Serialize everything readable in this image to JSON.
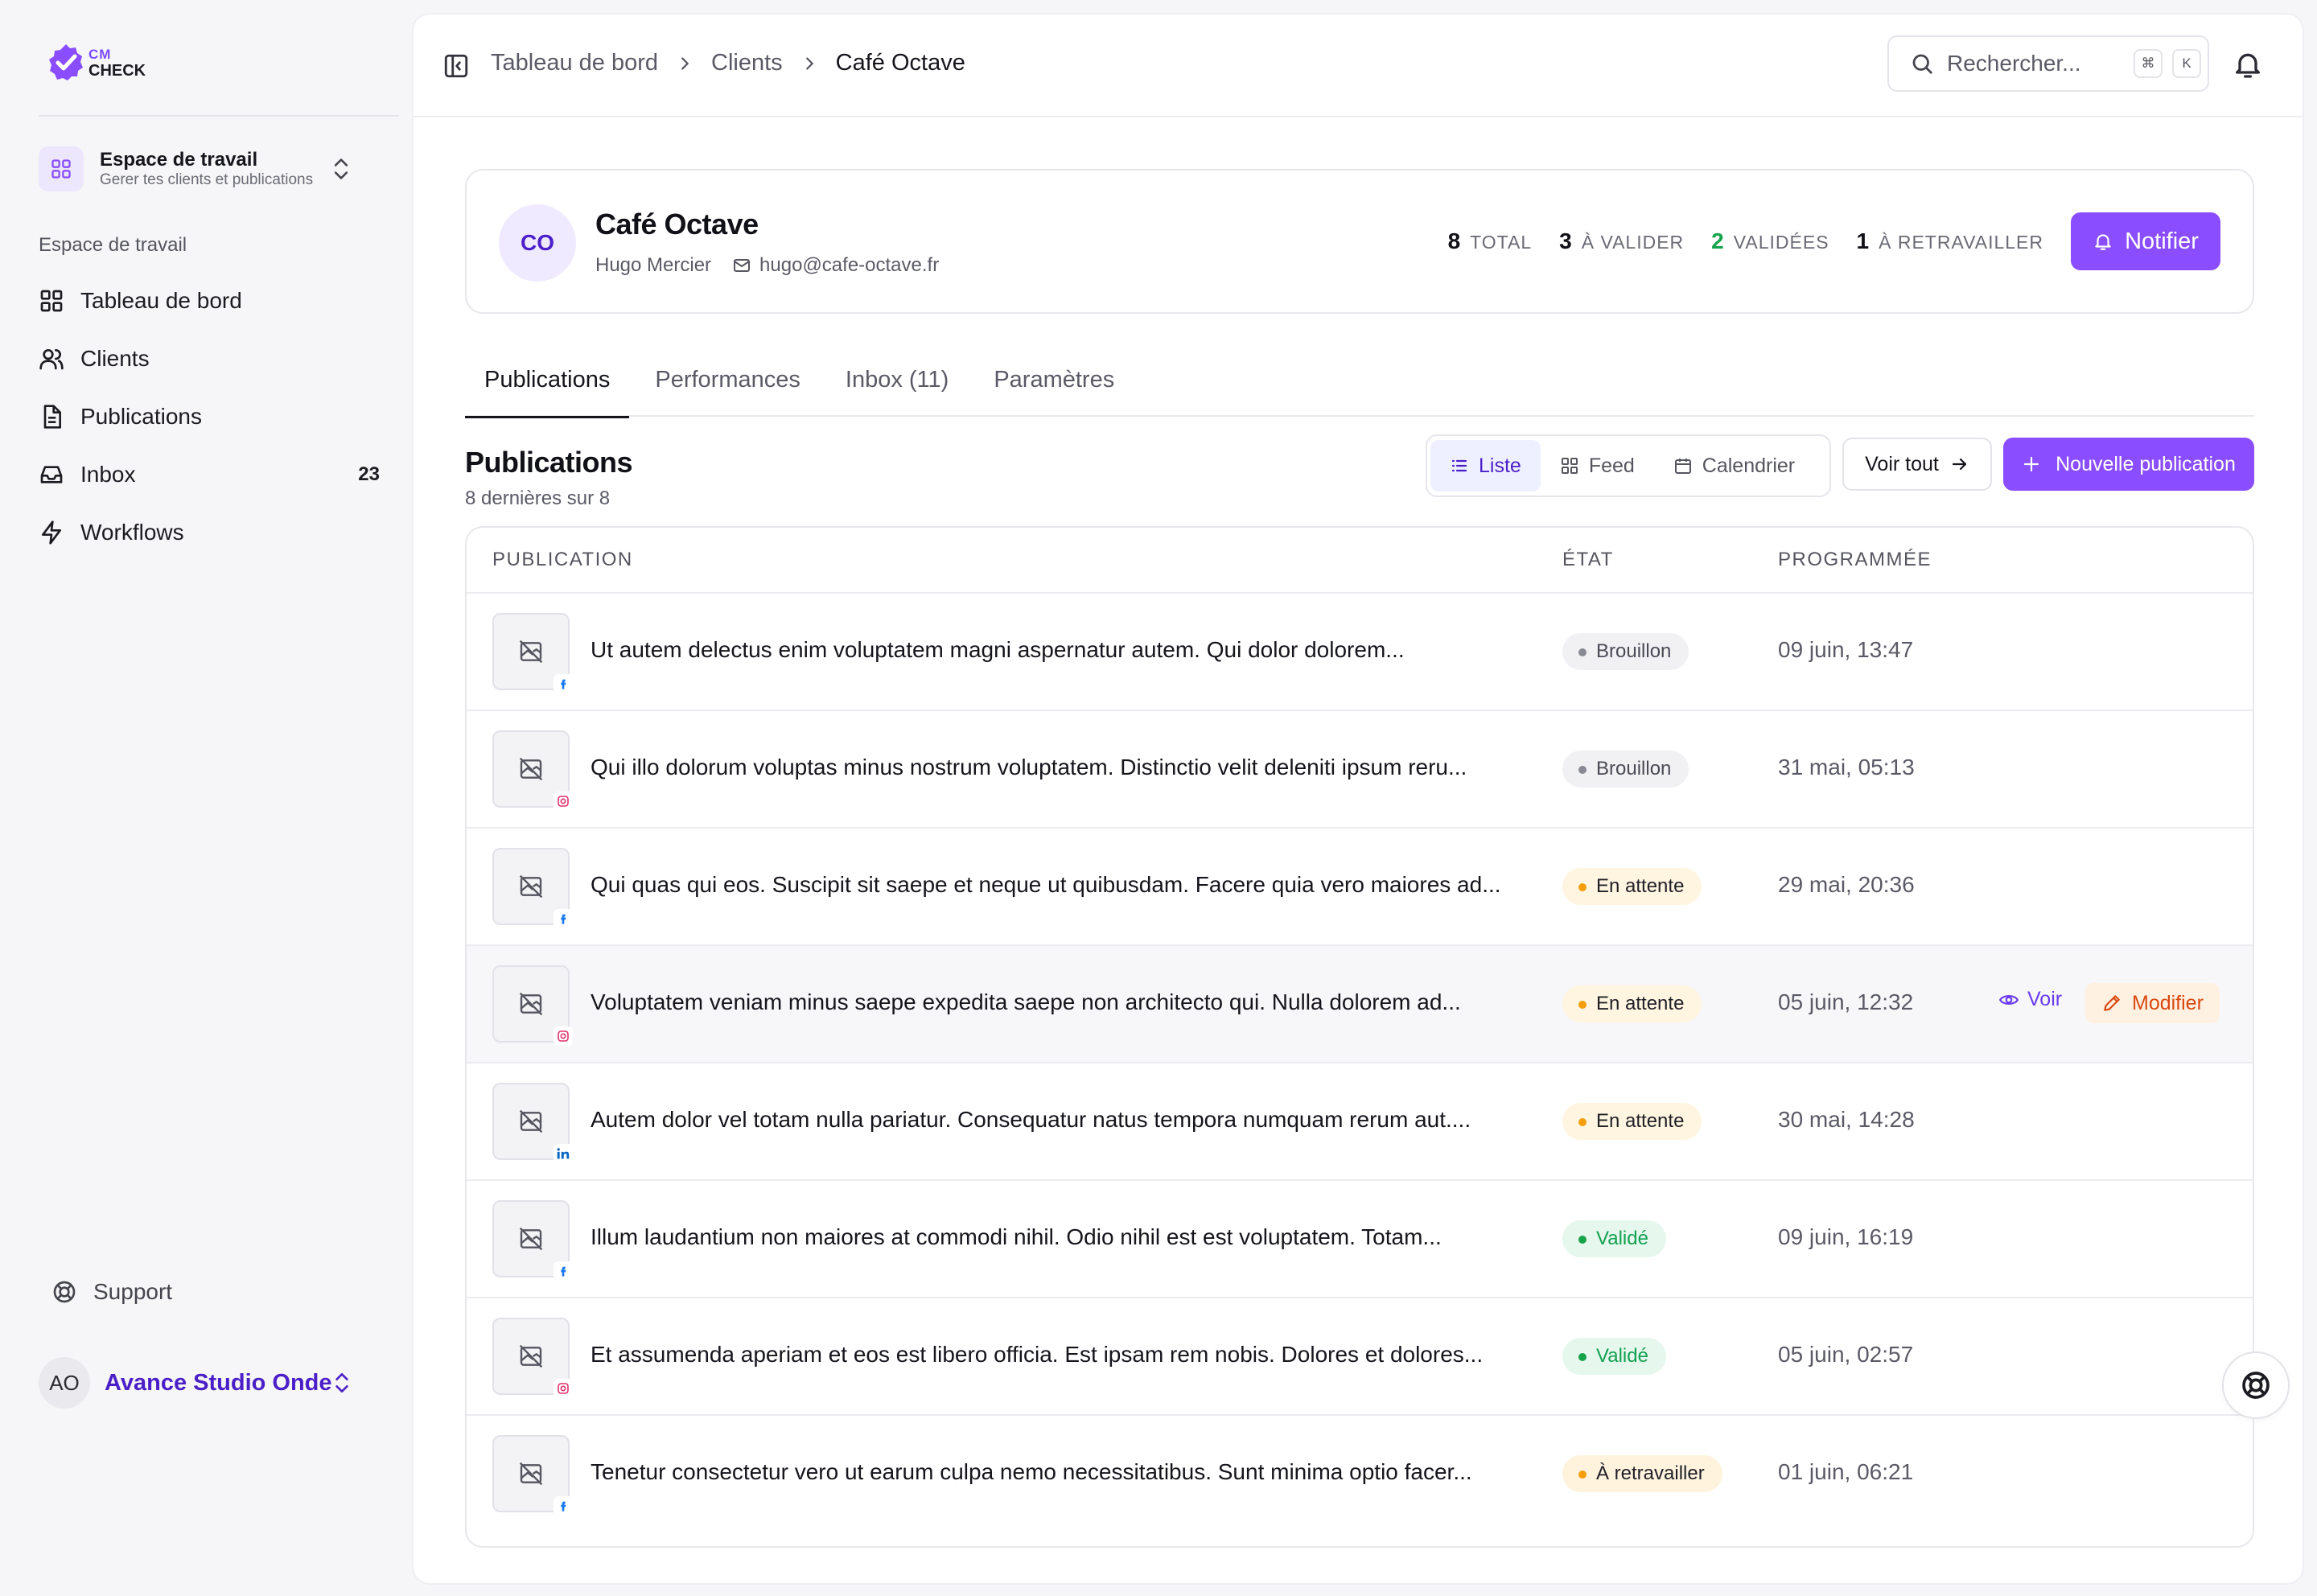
{
  "app": {
    "logo_top": "CM",
    "logo_bottom": "CHECK"
  },
  "sidebar": {
    "workspace_title": "Espace de travail",
    "workspace_subtitle": "Gerer tes clients et publications",
    "section_label": "Espace de travail",
    "items": [
      {
        "label": "Tableau de bord",
        "icon": "grid-icon"
      },
      {
        "label": "Clients",
        "icon": "users-icon"
      },
      {
        "label": "Publications",
        "icon": "document-icon"
      },
      {
        "label": "Inbox",
        "icon": "inbox-icon",
        "count": "23"
      },
      {
        "label": "Workflows",
        "icon": "lightning-icon"
      }
    ],
    "support_label": "Support",
    "user_initials": "AO",
    "user_name": "Avance Studio Onde"
  },
  "topbar": {
    "breadcrumbs": [
      "Tableau de bord",
      "Clients",
      "Café Octave"
    ],
    "search_placeholder": "Rechercher...",
    "shortcut_keys": [
      "⌘",
      "K"
    ]
  },
  "client": {
    "initials": "CO",
    "name": "Café Octave",
    "contact": "Hugo Mercier",
    "email": "hugo@cafe-octave.fr",
    "stats": [
      {
        "value": "8",
        "label": "TOTAL"
      },
      {
        "value": "3",
        "label": "À VALIDER"
      },
      {
        "value": "2",
        "label": "VALIDÉES"
      },
      {
        "value": "1",
        "label": "À RETRAVAILLER"
      }
    ],
    "notify_label": "Notifier"
  },
  "tabs": [
    "Publications",
    "Performances",
    "Inbox (11)",
    "Paramètres"
  ],
  "section": {
    "title": "Publications",
    "subtitle": "8 dernières sur 8",
    "views": [
      "Liste",
      "Feed",
      "Calendrier"
    ],
    "see_all": "Voir tout",
    "new_publication": "Nouvelle publication"
  },
  "table": {
    "headers": [
      "PUBLICATION",
      "ÉTAT",
      "PROGRAMMÉE"
    ],
    "rows": [
      {
        "text": "Ut autem delectus enim voluptatem magni aspernatur autem. Qui dolor dolorem...",
        "network": "facebook",
        "status": "Brouillon",
        "date": "09 juin, 13:47"
      },
      {
        "text": "Qui illo dolorum voluptas minus nostrum voluptatem. Distinctio velit deleniti ipsum reru...",
        "network": "instagram",
        "status": "Brouillon",
        "date": "31 mai, 05:13"
      },
      {
        "text": "Qui quas qui eos. Suscipit sit saepe et neque ut quibusdam. Facere quia vero maiores ad...",
        "network": "facebook",
        "status": "En attente",
        "date": "29 mai, 20:36"
      },
      {
        "text": "Voluptatem veniam minus saepe expedita saepe non architecto qui. Nulla dolorem ad...",
        "network": "instagram",
        "status": "En attente",
        "date": "05 juin, 12:32"
      },
      {
        "text": "Autem dolor vel totam nulla pariatur. Consequatur natus tempora numquam rerum aut....",
        "network": "linkedin",
        "status": "En attente",
        "date": "30 mai, 14:28"
      },
      {
        "text": "Illum laudantium non maiores at commodi nihil. Odio nihil est est voluptatem. Totam...",
        "network": "facebook",
        "status": "Validé",
        "date": "09 juin, 16:19"
      },
      {
        "text": "Et assumenda aperiam et eos est libero officia. Est ipsam rem nobis. Dolores et dolores...",
        "network": "instagram",
        "status": "Validé",
        "date": "05 juin, 02:57"
      },
      {
        "text": "Tenetur consectetur vero ut earum culpa nemo necessitatibus. Sunt minima optio facer...",
        "network": "facebook",
        "status": "À retravailler",
        "date": "01 juin, 06:21"
      }
    ],
    "row_actions": {
      "view": "Voir",
      "edit": "Modifier"
    }
  },
  "colors": {
    "accent": "#8a4dff",
    "accent_dark": "#4b1fc8",
    "validated": "#16a34a",
    "pending": "#f59e0b",
    "edit": "#d9480f"
  }
}
